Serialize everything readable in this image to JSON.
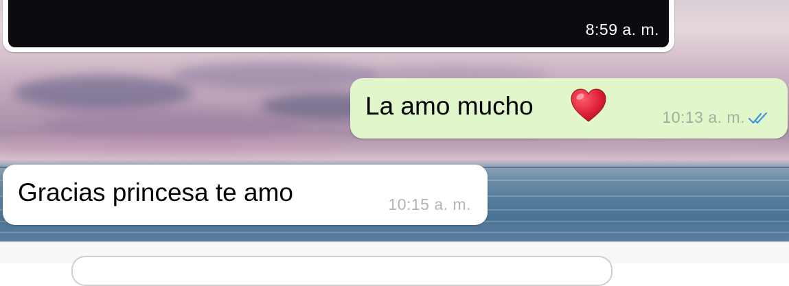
{
  "messages": [
    {
      "type": "video",
      "direction": "outgoing",
      "time": "8:59 a. m."
    },
    {
      "type": "text",
      "direction": "outgoing",
      "text": "La amo mucho",
      "emoji": "red-heart",
      "time": "10:13 a. m.",
      "status": "read"
    },
    {
      "type": "text",
      "direction": "incoming",
      "text": "Gracias princesa te amo",
      "time": "10:15 a. m."
    }
  ],
  "input": {
    "placeholder": ""
  },
  "colors": {
    "outgoing_bubble": "#e1f7cb",
    "incoming_bubble": "#ffffff",
    "read_ticks": "#3d95d9",
    "timestamp": "#a7aca3",
    "heart": "#e0243a"
  }
}
